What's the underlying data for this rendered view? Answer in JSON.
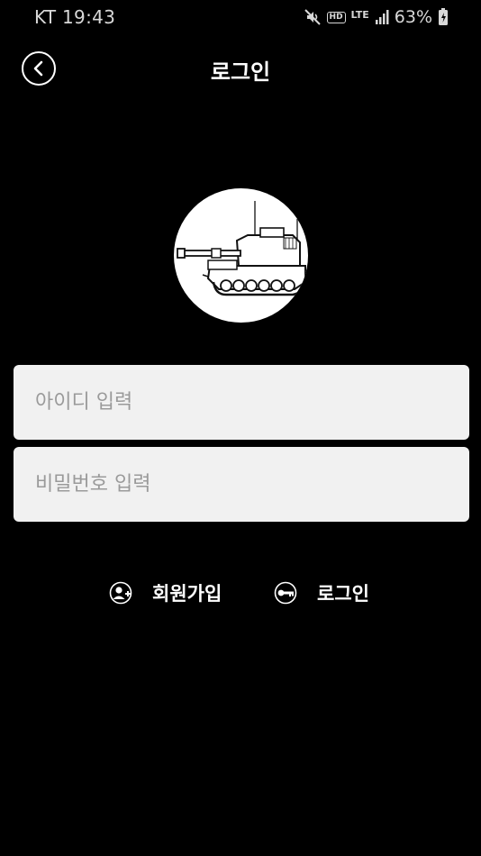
{
  "status_bar": {
    "carrier_time": "KT 19:43",
    "network": "LTE",
    "battery": "63%",
    "icons": [
      "mute-icon",
      "hd-voice-icon",
      "lte-icon",
      "signal-icon",
      "battery-icon"
    ]
  },
  "header": {
    "title": "로그인",
    "back_icon": "chevron-left-icon"
  },
  "logo": {
    "icon": "self-propelled-howitzer-illustration"
  },
  "form": {
    "id_placeholder": "아이디 입력",
    "password_placeholder": "비밀번호 입력"
  },
  "actions": {
    "signup_label": "회원가입",
    "signup_icon": "user-add-icon",
    "login_label": "로그인",
    "login_icon": "key-icon"
  },
  "colors": {
    "background": "#000000",
    "text": "#ffffff",
    "input_background": "#f1f1f1",
    "placeholder": "#9a9a9a"
  }
}
